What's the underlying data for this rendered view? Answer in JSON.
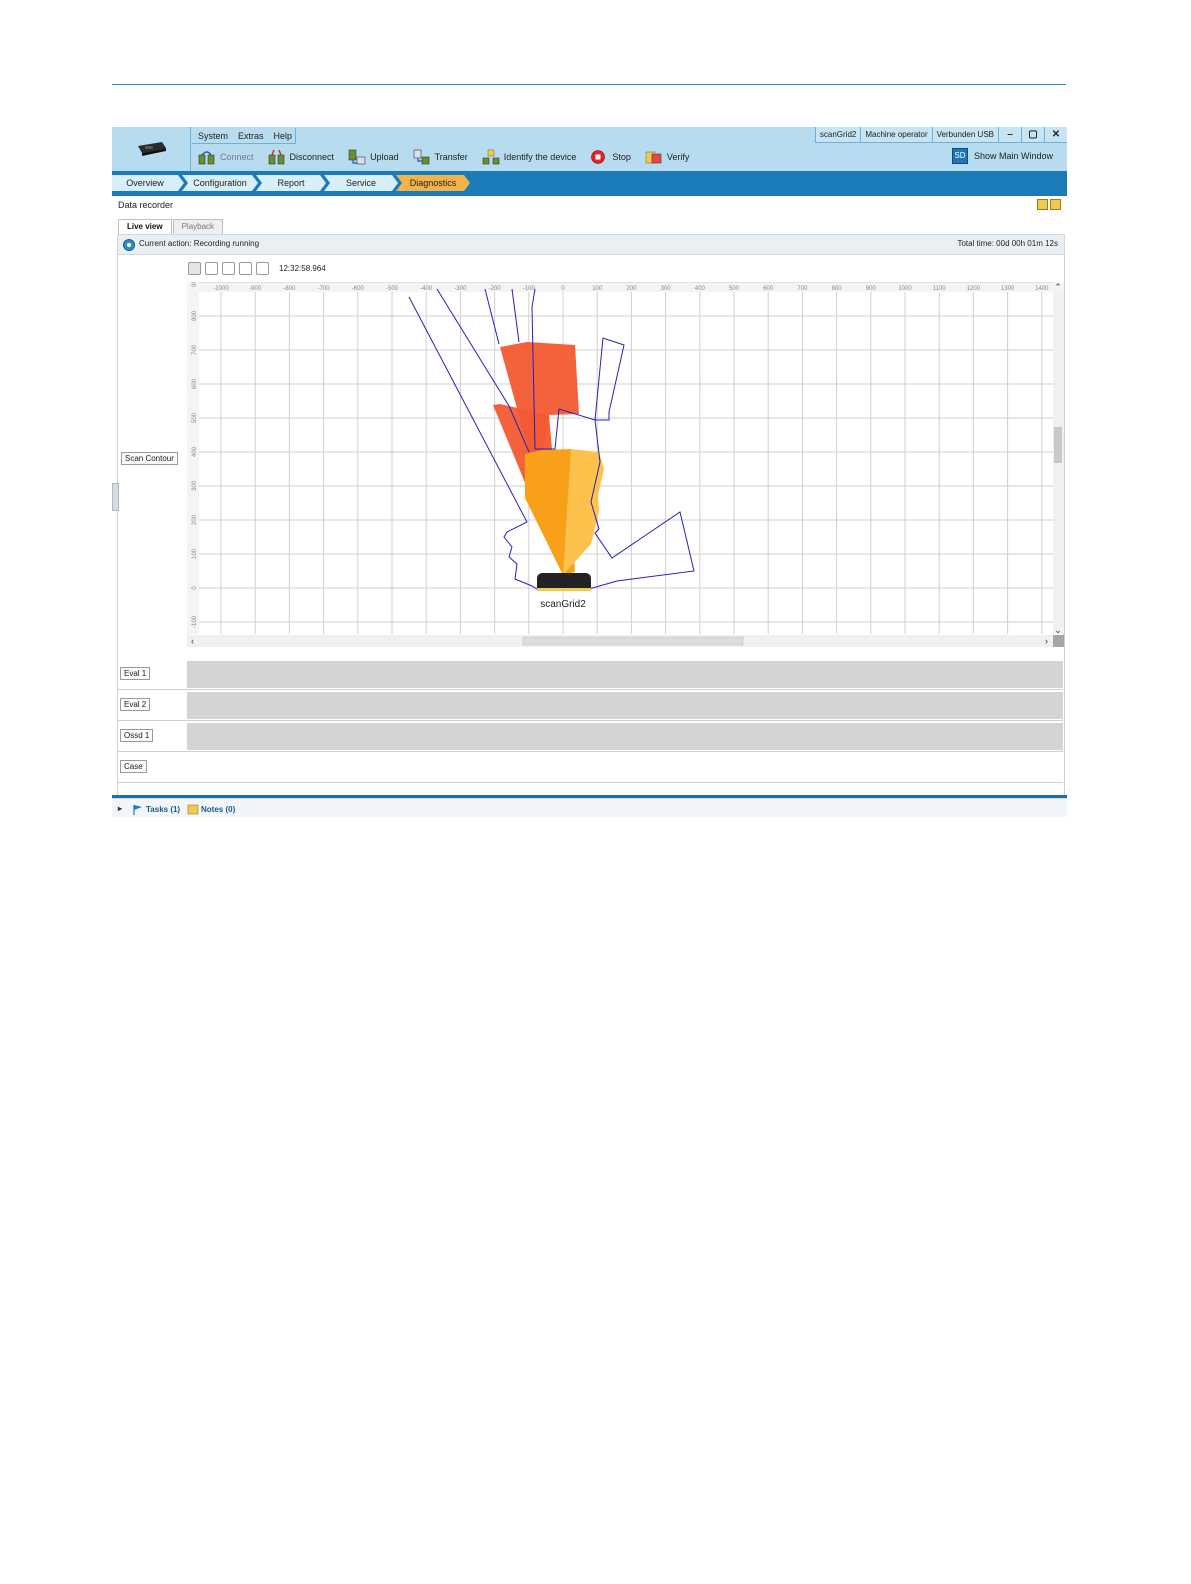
{
  "app": {
    "menu": [
      "System",
      "Extras",
      "Help"
    ],
    "status": {
      "device": "scanGrid2",
      "user_level": "Machine operator",
      "connection": "Verbunden USB"
    },
    "window_buttons": [
      "–",
      "▢",
      "✕"
    ],
    "toolbar": [
      {
        "label": "Connect",
        "icon": "connect-icon",
        "enabled": false
      },
      {
        "label": "Disconnect",
        "icon": "disconnect-icon",
        "enabled": true
      },
      {
        "label": "Upload",
        "icon": "upload-icon",
        "enabled": true
      },
      {
        "label": "Transfer",
        "icon": "transfer-icon",
        "enabled": true
      },
      {
        "label": "Identify the device",
        "icon": "identify-icon",
        "enabled": true
      },
      {
        "label": "Stop",
        "icon": "stop-icon",
        "enabled": true
      },
      {
        "label": "Verify",
        "icon": "verify-icon",
        "enabled": true
      }
    ],
    "show_main": {
      "icon_text": "SD",
      "label": "Show Main Window"
    }
  },
  "nav": {
    "items": [
      "Overview",
      "Configuration",
      "Report",
      "Service",
      "Diagnostics"
    ],
    "active": "Diagnostics"
  },
  "recorder": {
    "title": "Data recorder",
    "tabs": [
      "Live view",
      "Playback"
    ],
    "active_tab": "Live view",
    "current_action": "Current action:  Recording running",
    "total_time": "Total time:  00d 00h 01m 12s",
    "timestamp": "12:32:58.964",
    "scan_contour_button": "Scan Contour",
    "device_label": "scanGrid2",
    "rows": [
      "Eval 1",
      "Eval 2",
      "Ossd 1",
      "Case"
    ]
  },
  "chart_data": {
    "type": "scatter",
    "x_ticks": [
      "-1000",
      "-900",
      "-800",
      "-700",
      "-600",
      "-500",
      "-400",
      "-300",
      "-200",
      "-100",
      "0",
      "100",
      "200",
      "300",
      "400",
      "500",
      "600",
      "700",
      "800",
      "900",
      "1000",
      "1100",
      "1200",
      "1300",
      "1400"
    ],
    "y_ticks": [
      "900",
      "800",
      "700",
      "600",
      "500",
      "400",
      "300",
      "200",
      "100",
      "0",
      "-100"
    ]
  },
  "colors": {
    "accent": "#1a7bb8",
    "header": "#b7dcef",
    "active_tab": "#f4b24a",
    "field_red": "#f35a32",
    "field_orange": "#f9a01b",
    "field_yellow": "#fcc24c",
    "contour": "#2222bb"
  },
  "bottom": {
    "tasks": "Tasks (1)",
    "notes": "Notes (0)"
  }
}
